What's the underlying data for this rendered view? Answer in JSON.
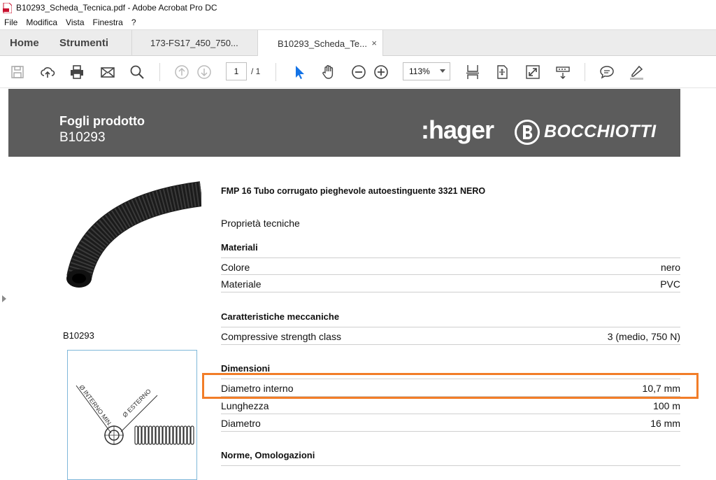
{
  "window": {
    "title": "B10293_Scheda_Tecnica.pdf - Adobe Acrobat Pro DC"
  },
  "menu": [
    "File",
    "Modifica",
    "Vista",
    "Finestra",
    "?"
  ],
  "tabs": {
    "home": "Home",
    "tools": "Strumenti",
    "documents": [
      {
        "label": "173-FS17_450_750...",
        "active": false
      },
      {
        "label": "B10293_Scheda_Te...",
        "active": true
      }
    ],
    "close_glyph": "×"
  },
  "toolbar": {
    "icons": [
      "save-icon",
      "cloud-upload-icon",
      "print-icon",
      "email-icon",
      "search-icon",
      "page-up-icon",
      "page-down-icon",
      "select-arrow-icon",
      "hand-icon",
      "zoom-out-icon",
      "zoom-in-icon",
      "fit-width-icon",
      "fit-page-icon",
      "fullscreen-icon",
      "scroll-mode-icon",
      "comment-icon",
      "highlight-pen-icon"
    ],
    "page_current": "1",
    "page_total": "/ 1",
    "zoom": "113%"
  },
  "document": {
    "banner_title": "Fogli prodotto",
    "banner_code": "B10293",
    "brand_1": ":hager",
    "brand_2": "BOCCHIOTTI",
    "product_title": "FMP 16 Tubo corrugato pieghevole autoestinguente 3321 NERO",
    "section_intro": "Proprietà tecniche",
    "image_code": "B10293",
    "drawing_labels": [
      "Ø INTERNO MIN.",
      "Ø ESTERNO"
    ],
    "sections": [
      {
        "heading": "Materiali",
        "rows": [
          {
            "key": "Colore",
            "value": "nero"
          },
          {
            "key": "Materiale",
            "value": "PVC"
          }
        ]
      },
      {
        "heading": "Caratteristiche meccaniche",
        "rows": [
          {
            "key": "Compressive strength class",
            "value": "3 (medio, 750 N)"
          }
        ]
      },
      {
        "heading": "Dimensioni",
        "rows": [
          {
            "key": "Diametro interno",
            "value": "10,7 mm",
            "highlighted": true
          },
          {
            "key": "Lunghezza",
            "value": "100 m"
          },
          {
            "key": "Diametro",
            "value": "16 mm"
          }
        ]
      },
      {
        "heading": "Norme, Omologazioni",
        "rows": []
      }
    ]
  },
  "colors": {
    "banner": "#5c5c5c",
    "highlight": "#f27d28",
    "accent_blue": "#1473e6"
  }
}
